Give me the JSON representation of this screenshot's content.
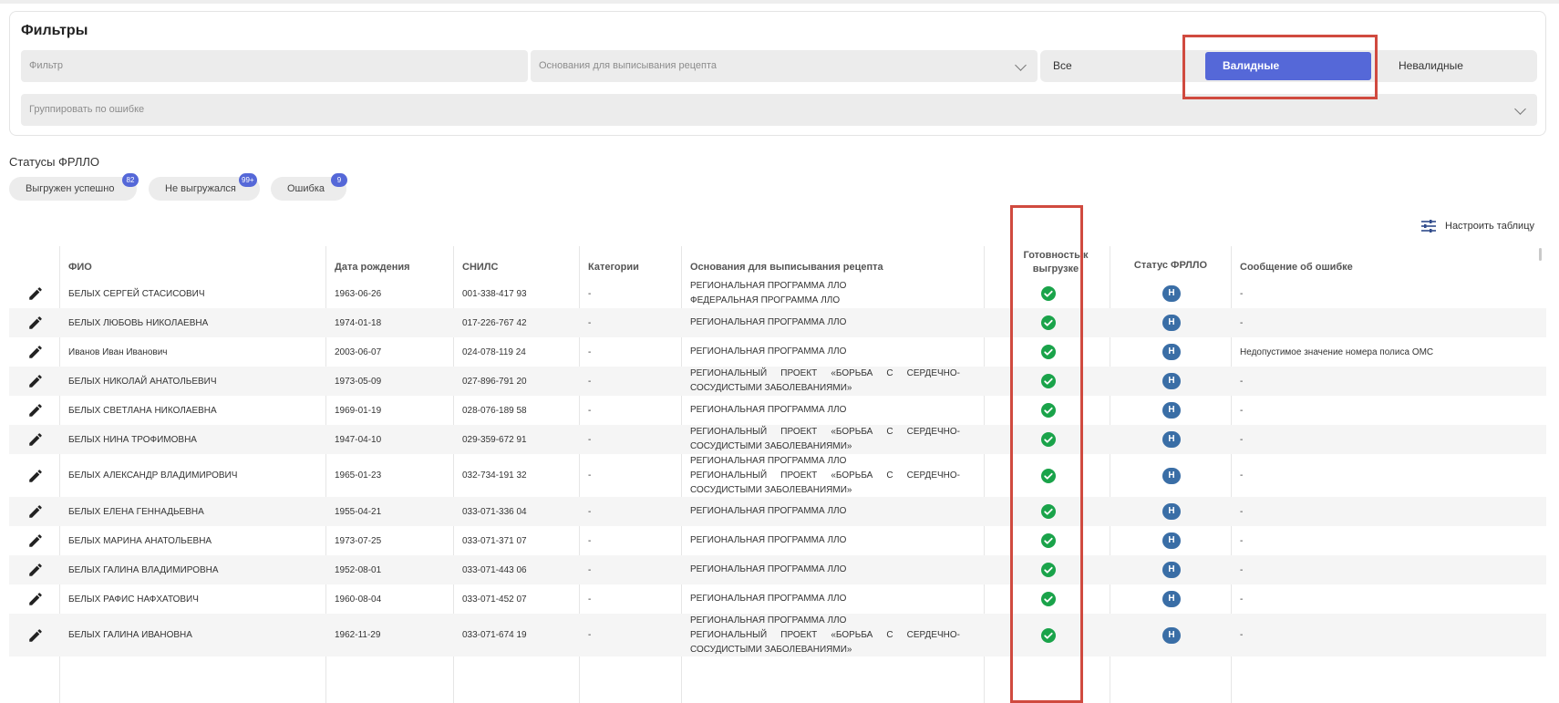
{
  "filters": {
    "title": "Фильтры",
    "filter_placeholder": "Фильтр",
    "basis_placeholder": "Основания для выписывания рецепта",
    "group_placeholder": "Группировать по ошибке",
    "segments": {
      "all": "Все",
      "valid": "Валидные",
      "invalid": "Невалидные"
    },
    "accent_color": "#5568d8"
  },
  "statuses": {
    "title": "Статусы ФРЛЛО",
    "chips": [
      {
        "label": "Выгружен успешно",
        "count": "82"
      },
      {
        "label": "Не выгружался",
        "count": "99+"
      },
      {
        "label": "Ошибка",
        "count": "9"
      }
    ]
  },
  "toolbar": {
    "configure_label": "Настроить таблицу"
  },
  "table": {
    "columns": {
      "fio": "ФИО",
      "dob": "Дата рождения",
      "snils": "СНИЛС",
      "categories": "Категории",
      "basis": "Основания для выписывания рецепта",
      "ready": "Готовность к выгрузке",
      "frllo": "Статус ФРЛЛО",
      "error": "Сообщение об ошибке"
    },
    "rows": [
      {
        "fio": "БЕЛЫХ СЕРГЕЙ СТАСИСОВИЧ",
        "dob": "1963-06-26",
        "snils": "001-338-417 93",
        "categories": "-",
        "basis": [
          "РЕГИОНАЛЬНАЯ ПРОГРАММА ЛЛО",
          "ФЕДЕРАЛЬНАЯ ПРОГРАММА ЛЛО"
        ],
        "frllo": "Н",
        "error": "-"
      },
      {
        "fio": "БЕЛЫХ ЛЮБОВЬ НИКОЛАЕВНА",
        "dob": "1974-01-18",
        "snils": "017-226-767 42",
        "categories": "-",
        "basis": [
          "РЕГИОНАЛЬНАЯ ПРОГРАММА ЛЛО"
        ],
        "frllo": "Н",
        "error": "-"
      },
      {
        "fio": "Иванов Иван Иванович",
        "dob": "2003-06-07",
        "snils": "024-078-119 24",
        "categories": "-",
        "basis": [
          "РЕГИОНАЛЬНАЯ ПРОГРАММА ЛЛО"
        ],
        "frllo": "Н",
        "error": "Недопустимое значение номера полиса ОМС"
      },
      {
        "fio": "БЕЛЫХ НИКОЛАЙ АНАТОЛЬЕВИЧ",
        "dob": "1973-05-09",
        "snils": "027-896-791 20",
        "categories": "-",
        "basis": [
          "РЕГИОНАЛЬНЫЙ ПРОЕКТ «БОРЬБА С СЕРДЕЧНО-СОСУДИСТЫМИ ЗАБОЛЕВАНИЯМИ»"
        ],
        "frllo": "Н",
        "error": "-"
      },
      {
        "fio": "БЕЛЫХ СВЕТЛАНА НИКОЛАЕВНА",
        "dob": "1969-01-19",
        "snils": "028-076-189 58",
        "categories": "-",
        "basis": [
          "РЕГИОНАЛЬНАЯ ПРОГРАММА ЛЛО"
        ],
        "frllo": "Н",
        "error": "-"
      },
      {
        "fio": "БЕЛЫХ НИНА ТРОФИМОВНА",
        "dob": "1947-04-10",
        "snils": "029-359-672 91",
        "categories": "-",
        "basis": [
          "РЕГИОНАЛЬНЫЙ ПРОЕКТ «БОРЬБА С СЕРДЕЧНО-СОСУДИСТЫМИ ЗАБОЛЕВАНИЯМИ»"
        ],
        "frllo": "Н",
        "error": "-"
      },
      {
        "fio": "БЕЛЫХ АЛЕКСАНДР ВЛАДИМИРОВИЧ",
        "dob": "1965-01-23",
        "snils": "032-734-191 32",
        "categories": "-",
        "basis": [
          "РЕГИОНАЛЬНАЯ ПРОГРАММА ЛЛО",
          "РЕГИОНАЛЬНЫЙ ПРОЕКТ «БОРЬБА С СЕРДЕЧНО-СОСУДИСТЫМИ ЗАБОЛЕВАНИЯМИ»"
        ],
        "frllo": "Н",
        "error": "-"
      },
      {
        "fio": "БЕЛЫХ ЕЛЕНА ГЕННАДЬЕВНА",
        "dob": "1955-04-21",
        "snils": "033-071-336 04",
        "categories": "-",
        "basis": [
          "РЕГИОНАЛЬНАЯ ПРОГРАММА ЛЛО"
        ],
        "frllo": "Н",
        "error": "-"
      },
      {
        "fio": "БЕЛЫХ МАРИНА АНАТОЛЬЕВНА",
        "dob": "1973-07-25",
        "snils": "033-071-371 07",
        "categories": "-",
        "basis": [
          "РЕГИОНАЛЬНАЯ ПРОГРАММА ЛЛО"
        ],
        "frllo": "Н",
        "error": "-"
      },
      {
        "fio": "БЕЛЫХ ГАЛИНА ВЛАДИМИРОВНА",
        "dob": "1952-08-01",
        "snils": "033-071-443 06",
        "categories": "-",
        "basis": [
          "РЕГИОНАЛЬНАЯ ПРОГРАММА ЛЛО"
        ],
        "frllo": "Н",
        "error": "-"
      },
      {
        "fio": "БЕЛЫХ РАФИС НАФХАТОВИЧ",
        "dob": "1960-08-04",
        "snils": "033-071-452 07",
        "categories": "-",
        "basis": [
          "РЕГИОНАЛЬНАЯ ПРОГРАММА ЛЛО"
        ],
        "frllo": "Н",
        "error": "-"
      },
      {
        "fio": "БЕЛЫХ ГАЛИНА ИВАНОВНА",
        "dob": "1962-11-29",
        "snils": "033-071-674 19",
        "categories": "-",
        "basis": [
          "РЕГИОНАЛЬНАЯ ПРОГРАММА ЛЛО",
          "РЕГИОНАЛЬНЫЙ ПРОЕКТ «БОРЬБА С СЕРДЕЧНО-СОСУДИСТЫМИ ЗАБОЛЕВАНИЯМИ»"
        ],
        "frllo": "Н",
        "error": "-"
      }
    ],
    "ready_icon": "check-circle-icon",
    "ready_color": "#1aa34a",
    "edit_icon": "pencil-icon"
  }
}
